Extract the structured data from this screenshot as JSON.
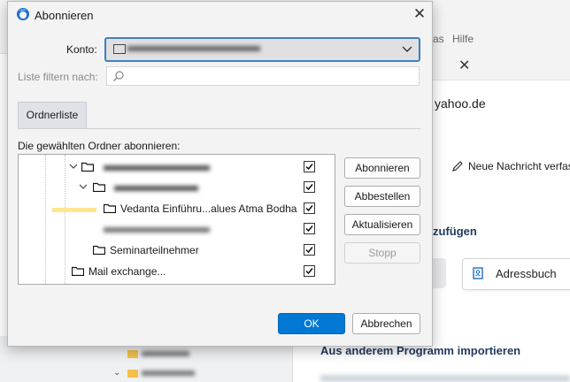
{
  "background": {
    "menu_text": "as",
    "menu_help": "Hilfe",
    "email_domain": "yahoo.de",
    "new_message_label": "Neue Nachricht verfas",
    "add_heading_fragment": "zufügen",
    "addressbook_label": "Adressbuch",
    "import_heading": "Aus anderem Programm importieren"
  },
  "dialog": {
    "title": "Abonnieren",
    "account_label": "Konto:",
    "filter_label": "Liste filtern nach:",
    "filter_placeholder": "",
    "tab_label": "Ordnerliste",
    "subscribe_heading": "Die gewählten Ordner abonnieren:",
    "folders": [
      {
        "name": "",
        "level": 1,
        "expanded": true,
        "checked": true
      },
      {
        "name": "",
        "level": 2,
        "expanded": true,
        "checked": true
      },
      {
        "name": "Vedanta Einführu...alues Atma Bodha",
        "level": 3,
        "checked": true
      },
      {
        "name": "",
        "level": 3,
        "checked": true
      },
      {
        "name": "Seminarteilnehmer",
        "level": 2,
        "checked": true
      },
      {
        "name": "Mail exchange...",
        "level": 0,
        "checked": true
      }
    ],
    "buttons": {
      "subscribe": "Abonnieren",
      "unsubscribe": "Abbestellen",
      "refresh": "Aktualisieren",
      "stop": "Stopp",
      "ok": "OK",
      "cancel": "Abbrechen"
    }
  },
  "colors": {
    "accent": "#0078d4",
    "focus_border": "#3b82c4"
  },
  "icons": [
    "thunderbird-icon",
    "close-icon",
    "chevron-down-icon",
    "search-icon",
    "folder-icon",
    "checkbox-checked-icon",
    "pencil-icon",
    "address-book-icon"
  ]
}
